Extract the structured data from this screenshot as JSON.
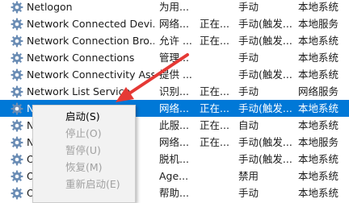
{
  "colors": {
    "selection": "#0078d7",
    "gear_icon": "#6b8db5",
    "arrow": "#e53935",
    "menu_background": "#f2f2f2",
    "disabled_text": "#a0a0a0"
  },
  "services": [
    {
      "name": "Netlogon",
      "desc": "为用...",
      "status": "",
      "startup": "手动",
      "logon": "本地系统"
    },
    {
      "name": "Network Connected Devi...",
      "desc": "网络...",
      "status": "正在...",
      "startup": "手动(触发...",
      "logon": "本地服务"
    },
    {
      "name": "Network Connection Bro...",
      "desc": "允许 ...",
      "status": "正在...",
      "startup": "手动(触发...",
      "logon": "本地系统"
    },
    {
      "name": "Network Connections",
      "desc": "管理...",
      "status": "",
      "startup": "手动",
      "logon": "本地系统"
    },
    {
      "name": "Network Connectivity Ass...",
      "desc": "提供 ...",
      "status": "",
      "startup": "手动(触发...",
      "logon": "本地系统"
    },
    {
      "name": "Network List Service",
      "desc": "识别...",
      "status": "正在...",
      "startup": "手动",
      "logon": "网络服务"
    },
    {
      "name": "Ne",
      "desc": "网络...",
      "status": "正在...",
      "startup": "手动(触发...",
      "logon": "本地系统"
    },
    {
      "name": "N",
      "desc": "此服...",
      "status": "正在...",
      "startup": "自动",
      "logon": "本地系统"
    },
    {
      "name": "N",
      "desc": "网络...",
      "status": "正在...",
      "startup": "手动(触发...",
      "logon": "本地服务"
    },
    {
      "name": "O",
      "desc": "脱机...",
      "status": "",
      "startup": "手动(触发...",
      "logon": "本地系统"
    },
    {
      "name": "O",
      "desc": "Age...",
      "status": "",
      "startup": "禁用",
      "logon": "本地系统"
    },
    {
      "name": "O",
      "desc": "帮助...",
      "status": "",
      "startup": "手动",
      "logon": "本地系统"
    }
  ],
  "context_menu": {
    "items": [
      {
        "label": "启动(S)",
        "enabled": true
      },
      {
        "label": "停止(O)",
        "enabled": false
      },
      {
        "label": "暂停(U)",
        "enabled": false
      },
      {
        "label": "恢复(M)",
        "enabled": false
      },
      {
        "label": "重新启动(E)",
        "enabled": false
      }
    ]
  }
}
